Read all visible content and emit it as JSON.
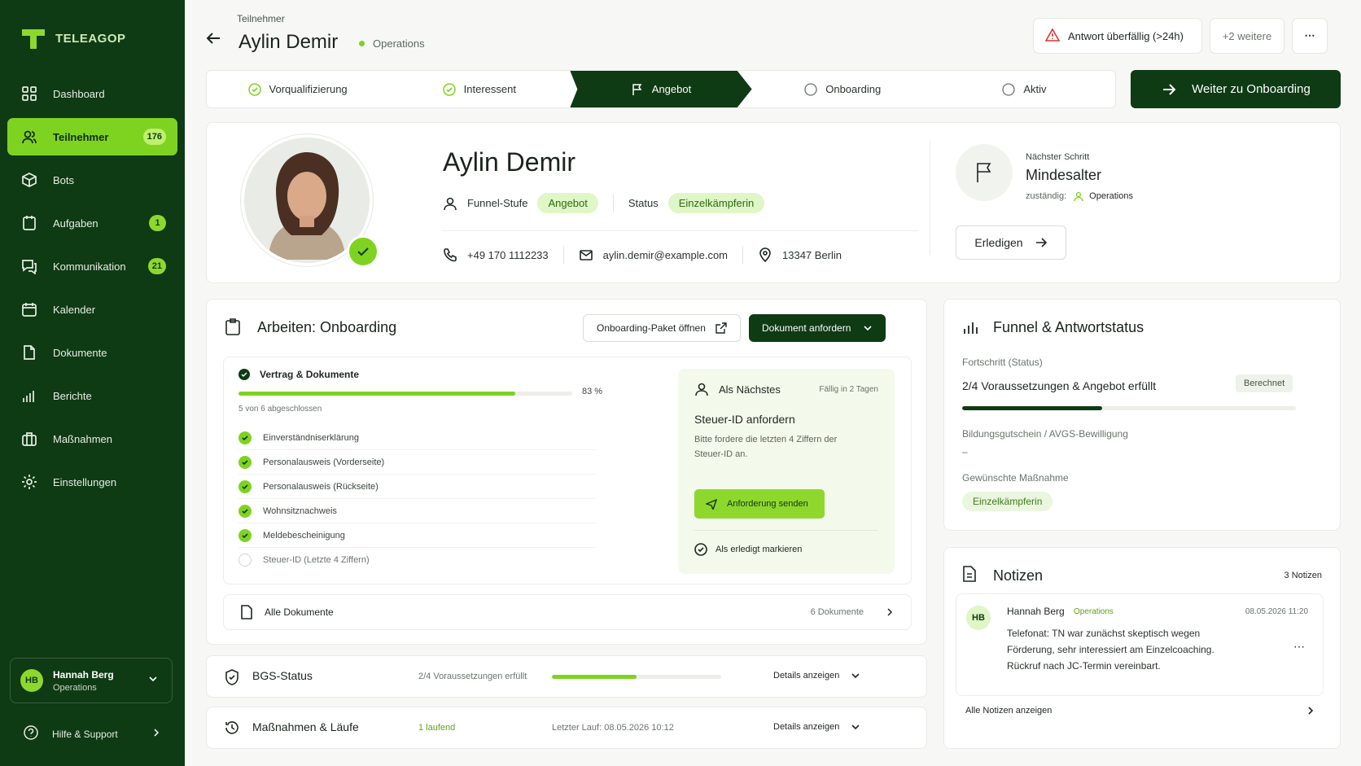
{
  "brand": {
    "name": "TELEAGOP",
    "accent": "#7ed321",
    "sidebar_bg": "#0e3a14"
  },
  "sidebar": {
    "items": [
      {
        "label": "Dashboard",
        "icon": "grid-icon",
        "badge": ""
      },
      {
        "label": "Teilnehmer",
        "icon": "users-icon",
        "badge": "176",
        "active": true
      },
      {
        "label": "Bots",
        "icon": "bot-icon",
        "badge": ""
      },
      {
        "label": "Aufgaben",
        "icon": "tasks-icon",
        "badge": "1"
      },
      {
        "label": "Kommunikation",
        "icon": "chat-icon",
        "badge": "21"
      },
      {
        "label": "Kalender",
        "icon": "calendar-icon",
        "badge": ""
      },
      {
        "label": "Dokumente",
        "icon": "document-icon",
        "badge": ""
      },
      {
        "label": "Berichte",
        "icon": "chart-icon",
        "badge": ""
      },
      {
        "label": "Maßnahmen",
        "icon": "briefcase-icon",
        "badge": ""
      },
      {
        "label": "Einstellungen",
        "icon": "gear-icon",
        "badge": ""
      }
    ],
    "user": {
      "initials": "HB",
      "name": "Hannah Berg",
      "role": "Operations"
    },
    "help": "Hilfe & Support"
  },
  "header": {
    "breadcrumb": "Teilnehmer",
    "title": "Aylin Demir",
    "team": "Operations",
    "alert": "Antwort überfällig (>24h)",
    "more": "+2 weitere"
  },
  "stepper": {
    "steps": [
      {
        "label": "Vorqualifizierung",
        "state": "done"
      },
      {
        "label": "Interessent",
        "state": "done"
      },
      {
        "label": "Angebot",
        "state": "active"
      },
      {
        "label": "Onboarding",
        "state": "open"
      },
      {
        "label": "Aktiv",
        "state": "open"
      }
    ],
    "cta": "Weiter zu Onboarding"
  },
  "profile": {
    "name": "Aylin Demir",
    "funnel_label": "Funnel-Stufe",
    "funnel_value": "Angebot",
    "status_label": "Status",
    "status_value": "Einzelkämpferin",
    "phone": "+49 170 1112233",
    "email": "aylin.demir@example.com",
    "location": "13347 Berlin",
    "next_label": "Nächster Schritt",
    "next_value": "Mindesalter",
    "owner_label": "zuständig:",
    "owner_value": "Operations",
    "done_button": "Erledigen"
  },
  "work": {
    "title": "Arbeiten: Onboarding",
    "open_pkg": "Onboarding-Paket öffnen",
    "request_doc": "Dokument anfordern",
    "section": "Vertrag & Dokumente",
    "progress_label": "83 %",
    "progress": 0.83,
    "summary": "5 von 6 abgeschlossen",
    "items": [
      {
        "label": "Einverständniserklärung",
        "done": true
      },
      {
        "label": "Personalausweis (Vorderseite)",
        "done": true
      },
      {
        "label": "Personalausweis (Rückseite)",
        "done": true
      },
      {
        "label": "Wohnsitznachweis",
        "done": true
      },
      {
        "label": "Meldebescheinigung",
        "done": true
      },
      {
        "label": "Steuer-ID (Letzte 4 Ziffern)",
        "done": false
      }
    ],
    "next": {
      "label": "Als Nächstes",
      "due": "Fällig in 2 Tagen",
      "title": "Steuer-ID anfordern",
      "desc": "Bitte fordere die letzten 4 Ziffern der Steuer-ID an.",
      "send": "Anforderung senden",
      "mark": "Als erledigt markieren"
    },
    "all_docs": "Alle Dokumente",
    "docs_count": "6 Dokumente"
  },
  "bgs": {
    "title": "BGS-Status",
    "summary": "2/4 Voraussetzungen erfüllt",
    "progress": 0.5,
    "details": "Details anzeigen"
  },
  "mass": {
    "title": "Maßnahmen & Läufe",
    "running": "1 laufend",
    "last": "Letzter Lauf: 08.05.2026 10:12",
    "details": "Details anzeigen"
  },
  "funnel": {
    "title": "Funnel & Antwortstatus",
    "progress_label": "Fortschritt (Status)",
    "progress_value": "2/4  Voraussetzungen & Angebot erfüllt",
    "badge": "Berechnet",
    "progress": 0.42,
    "bg_label": "Bildungsgutschein / AVGS-Bewilligung",
    "bg_value": "–",
    "measure_label": "Gewünschte Maßnahme",
    "measure_value": "Einzelkämpferin"
  },
  "notes": {
    "title": "Notizen",
    "count": "3 Notizen",
    "author_initials": "HB",
    "author": "Hannah Berg",
    "team": "Operations",
    "date": "08.05.2026 11:20",
    "text": "Telefonat: TN war zunächst skeptisch wegen Förderung, sehr interessiert am Einzelcoaching. Rückruf nach JC-Termin vereinbart.",
    "all": "Alle Notizen anzeigen"
  }
}
